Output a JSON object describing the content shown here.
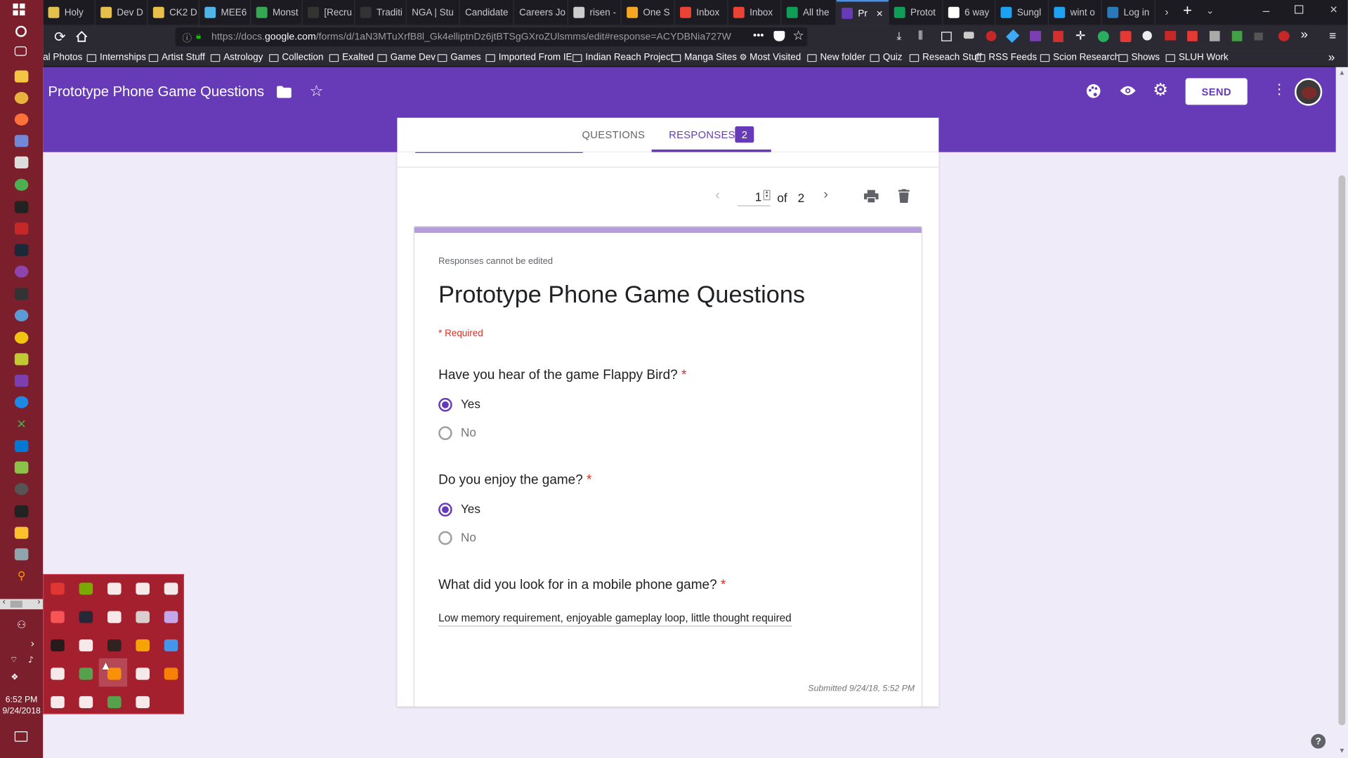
{
  "browser": {
    "tabs": [
      {
        "label": "Holy",
        "favicon": "#e5c14b"
      },
      {
        "label": "Dev D",
        "favicon": "#e5c14b"
      },
      {
        "label": "CK2 D",
        "favicon": "#e5c14b"
      },
      {
        "label": "MEE6",
        "favicon": "#4fb3e8"
      },
      {
        "label": "Monst",
        "favicon": "#34a853"
      },
      {
        "label": "[Recru",
        "favicon": "#333333"
      },
      {
        "label": "Traditi",
        "favicon": "#333333"
      },
      {
        "label": "NGA | Stu",
        "favicon": ""
      },
      {
        "label": "Candidate",
        "favicon": ""
      },
      {
        "label": "Careers Jo",
        "favicon": ""
      },
      {
        "label": "risen -",
        "favicon": "#cccccc"
      },
      {
        "label": "One S",
        "favicon": "#f5a623"
      },
      {
        "label": "Inbox",
        "favicon": "#ea4335"
      },
      {
        "label": "Inbox",
        "favicon": "#ea4335"
      },
      {
        "label": "All the",
        "favicon": "#0f9d58"
      },
      {
        "label": "Pr",
        "favicon": "#673ab7"
      },
      {
        "label": "Protot",
        "favicon": "#0f9d58"
      },
      {
        "label": "6 way",
        "favicon": "#ffffff"
      },
      {
        "label": "Sungl",
        "favicon": "#1da1f2"
      },
      {
        "label": "wint o",
        "favicon": "#1da1f2"
      },
      {
        "label": "Log in",
        "favicon": "#2a7ab8"
      }
    ],
    "url_prefix": "https://docs.",
    "url_domain": "google.com",
    "url_rest": "/forms/d/1aN3MTuXrfB8l_Gk4elliptnDz6jtBTSgGXroZUlsmms/edit#response=ACYDBNia727W",
    "bookmarks": [
      "al Photos",
      "Internships",
      "Artist Stuff",
      "Astrology",
      "Collection",
      "Exalted",
      "Game Dev",
      "Games",
      "Imported From IE",
      "Indian Reach Project",
      "Manga Sites",
      "Most Visited",
      "New folder",
      "Quiz",
      "Reseach Stuff",
      "RSS Feeds",
      "Scion Research",
      "Shows",
      "SLUH Work"
    ]
  },
  "forms_header": {
    "title": "Prototype Phone Game Questions",
    "send_label": "SEND",
    "accent": "#673ab7"
  },
  "tabs": {
    "questions_label": "QUESTIONS",
    "responses_label": "RESPONSES",
    "responses_count": "2"
  },
  "pager": {
    "current": "1",
    "of_label": "of",
    "total": "2"
  },
  "response": {
    "notice": "Responses cannot be edited",
    "title": "Prototype Phone Game Questions",
    "required_note": "* Required",
    "q1": {
      "text": "Have you hear of the game Flappy Bird?",
      "star": "*",
      "options": [
        "Yes",
        "No"
      ],
      "selected": "Yes"
    },
    "q2": {
      "text": "Do you enjoy the game?",
      "star": "*",
      "options": [
        "Yes",
        "No"
      ],
      "selected": "Yes"
    },
    "q3": {
      "text": "What did you look for in a mobile phone game?",
      "star": "*",
      "answer": "Low memory requirement, enjoyable gameplay loop, little thought required"
    },
    "submitted": "Submitted 9/24/18, 5:52 PM"
  },
  "system": {
    "time": "6:52 PM",
    "date": "9/24/2018"
  },
  "tray_icons": [
    "gmail-icon",
    "nvidia-icon",
    "cloud-icon",
    "signal-icon",
    "usb-icon",
    "settings-icon",
    "steam-icon",
    "nitro-icon",
    "bar-icon",
    "messenger-icon",
    "shield-icon",
    "wifi-icon",
    "terminal-icon",
    "headset-icon",
    "globe-icon",
    "paint-icon",
    "chrome-icon",
    "magnifier-icon",
    "discord-icon",
    "origin-icon",
    "dropbox-icon",
    "lines-icon",
    "xbox-icon",
    "drive-icon"
  ]
}
